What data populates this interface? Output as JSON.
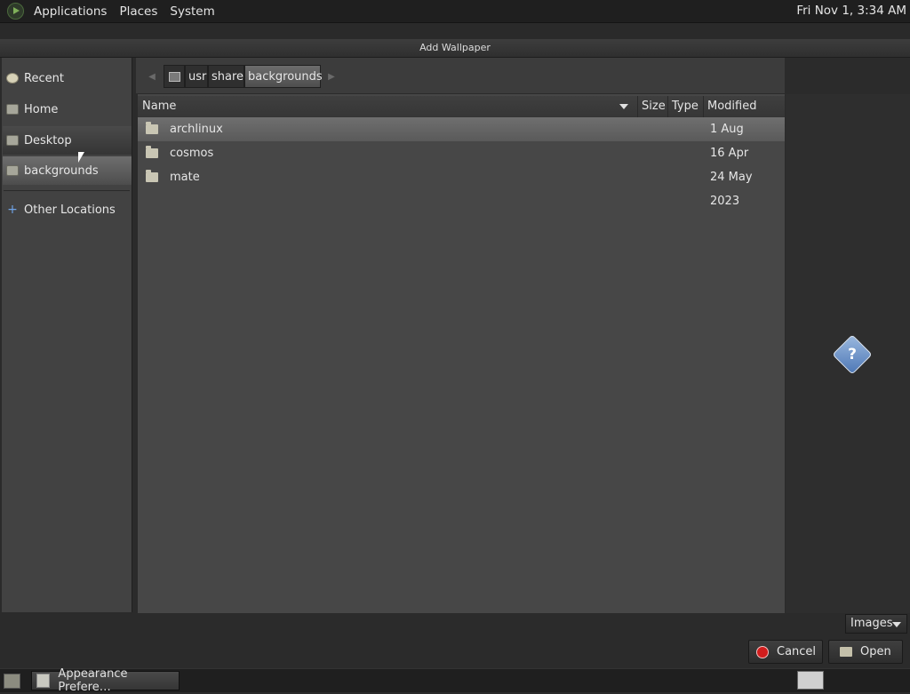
{
  "top_panel": {
    "menus": [
      "Applications",
      "Places",
      "System"
    ],
    "clock": "Fri Nov 1,  3:34 AM"
  },
  "dialog": {
    "title": "Add Wallpaper"
  },
  "sidebar": {
    "items": [
      {
        "label": "Recent",
        "icon": "recent-icon"
      },
      {
        "label": "Home",
        "icon": "home-folder-icon"
      },
      {
        "label": "Desktop",
        "icon": "desktop-folder-icon"
      },
      {
        "label": "backgrounds",
        "icon": "folder-icon"
      },
      {
        "label": "Other Locations",
        "icon": "plus-icon"
      }
    ]
  },
  "path_bar": {
    "crumbs": [
      "usr",
      "share",
      "backgrounds"
    ],
    "active": "backgrounds"
  },
  "file_list": {
    "columns": [
      "Name",
      "Size",
      "Type",
      "Modified"
    ],
    "rows": [
      {
        "name": "archlinux",
        "size": "",
        "type": "",
        "modified": "1 Aug"
      },
      {
        "name": "cosmos",
        "size": "",
        "type": "",
        "modified": "16 Apr"
      },
      {
        "name": "mate",
        "size": "",
        "type": "",
        "modified": "24 May 2023"
      }
    ]
  },
  "filter": {
    "selected": "Images"
  },
  "buttons": {
    "cancel": "Cancel",
    "open": "Open"
  },
  "taskbar": {
    "task_label": "Appearance Prefere…"
  },
  "colors": {
    "selection": "#6f6f6f",
    "cancel_icon": "#d11d1d",
    "help_icon": "#4e78b6"
  }
}
